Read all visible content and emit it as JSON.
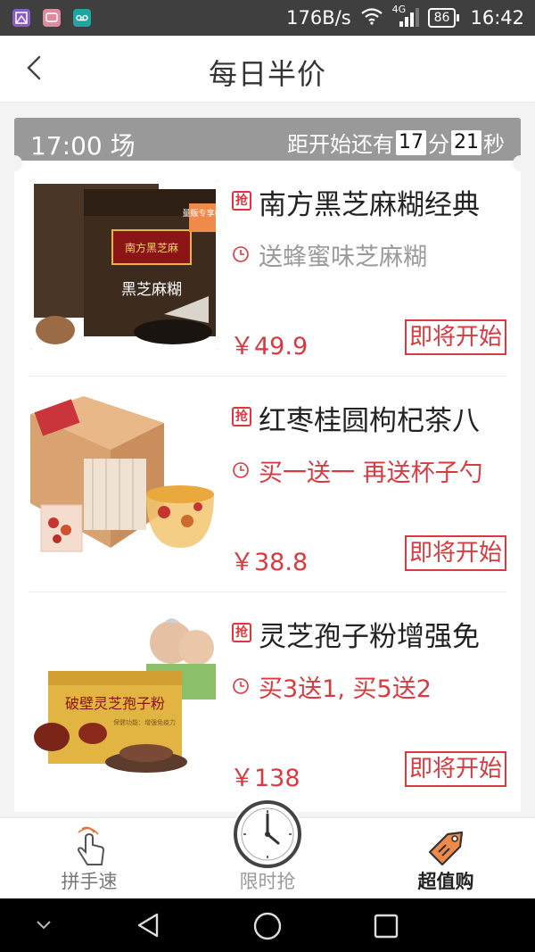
{
  "status_bar": {
    "net_speed": "176B/s",
    "network_type": "4G",
    "battery": "86",
    "time": "16:42",
    "icons": [
      "gallery-app-icon",
      "message-app-icon",
      "voicemail-app-icon",
      "wifi-icon",
      "signal-icon",
      "battery-icon"
    ]
  },
  "header": {
    "title": "每日半价",
    "back_icon": "chevron-left-icon"
  },
  "session": {
    "time_label": "17:00 场",
    "countdown_prefix": "距开始还有",
    "minutes": "17",
    "minutes_unit": "分",
    "seconds": "21",
    "seconds_unit": "秒"
  },
  "products": [
    {
      "badge": "抢",
      "title": "南方黑芝麻糊经典",
      "promo": "送蜂蜜味芝麻糊",
      "promo_color": "#9a9a9a",
      "price": "￥49.9",
      "button_label": "即将开始",
      "image_brand": "南方黑芝麻",
      "image_name": "黑芝麻糊",
      "image_tag": "量贩专享装"
    },
    {
      "badge": "抢",
      "title": "红枣桂圆枸杞茶八",
      "promo": "买一送一 再送杯子勺",
      "promo_color": "#d83a3f",
      "price": "￥38.8",
      "button_label": "即将开始"
    },
    {
      "badge": "抢",
      "title": "灵芝孢子粉增强免",
      "promo": "买3送1, 买5送2",
      "promo_color": "#d83a3f",
      "price": "￥138",
      "button_label": "即将开始",
      "image_name": "破壁灵芝孢子粉",
      "image_subtitle": "保健功能：增强免疫力"
    }
  ],
  "tabs": [
    {
      "label": "拼手速",
      "icon": "hand-tap-icon",
      "active": false
    },
    {
      "label": "限时抢",
      "icon": "clock-icon",
      "active": false
    },
    {
      "label": "超值购",
      "icon": "price-tag-icon",
      "active": true
    }
  ],
  "colors": {
    "accent": "#d83a3f",
    "session_bar": "#999999",
    "status_bar": "#3f3f3f",
    "tag_orange": "#f08a4b"
  }
}
